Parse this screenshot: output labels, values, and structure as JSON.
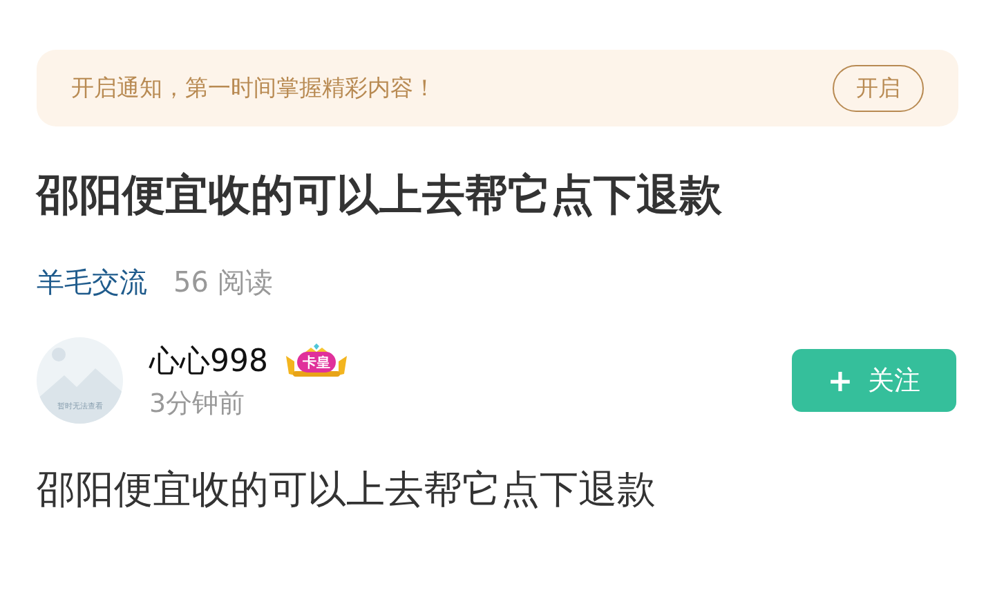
{
  "notice": {
    "text": "开启通知，第一时间掌握精彩内容！",
    "button": "开启"
  },
  "post": {
    "title": "邵阳便宜收的可以上去帮它点下退款",
    "category": "羊毛交流",
    "reads": "56 阅读",
    "author": {
      "avatar_caption": "暂时无法查看",
      "name": "心心998",
      "badge": "卡皇",
      "time": "3分钟前"
    },
    "follow_button": {
      "icon": "+",
      "label": "关注"
    },
    "body": "邵阳便宜收的可以上去帮它点下退款"
  }
}
